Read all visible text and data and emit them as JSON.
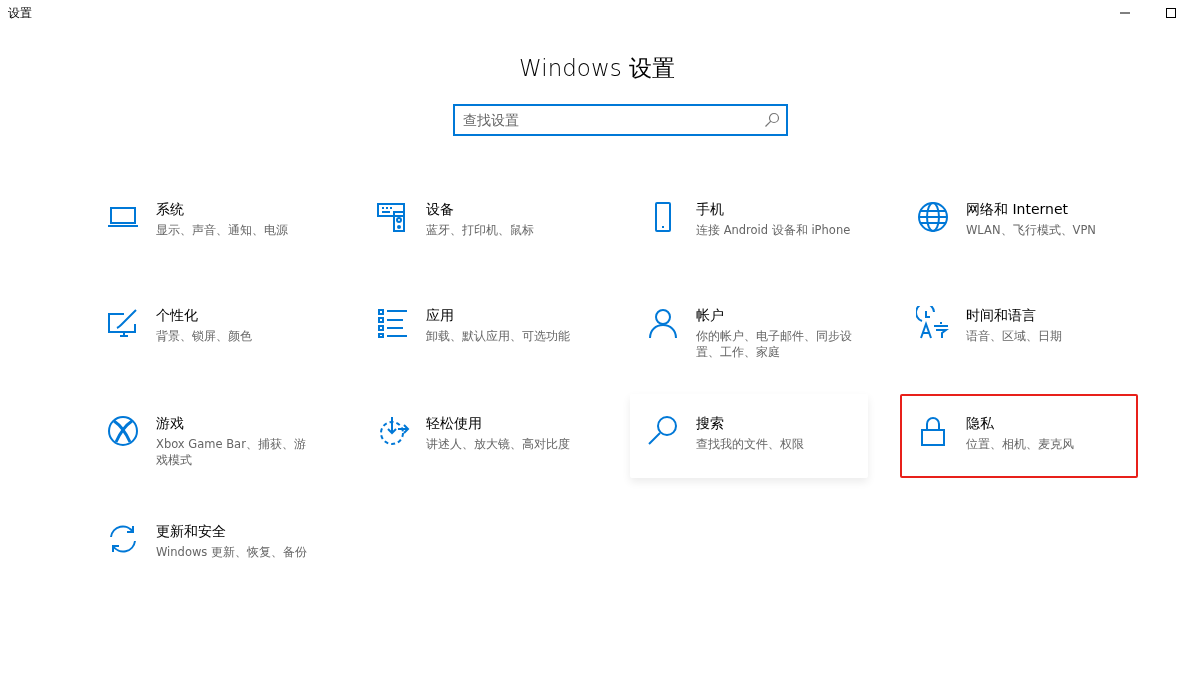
{
  "window": {
    "title": "设置"
  },
  "heading": "Windows 设置",
  "search": {
    "placeholder": "查找设置"
  },
  "tiles": [
    {
      "kind": "system",
      "title": "系统",
      "subtitle": "显示、声音、通知、电源",
      "highlighted": false,
      "hovered": false
    },
    {
      "kind": "devices",
      "title": "设备",
      "subtitle": "蓝牙、打印机、鼠标",
      "highlighted": false,
      "hovered": false
    },
    {
      "kind": "phone",
      "title": "手机",
      "subtitle": "连接 Android 设备和 iPhone",
      "highlighted": false,
      "hovered": false
    },
    {
      "kind": "network",
      "title": "网络和 Internet",
      "subtitle": "WLAN、飞行模式、VPN",
      "highlighted": false,
      "hovered": false
    },
    {
      "kind": "personalization",
      "title": "个性化",
      "subtitle": "背景、锁屏、颜色",
      "highlighted": false,
      "hovered": false
    },
    {
      "kind": "apps",
      "title": "应用",
      "subtitle": "卸载、默认应用、可选功能",
      "highlighted": false,
      "hovered": false
    },
    {
      "kind": "accounts",
      "title": "帐户",
      "subtitle": "你的帐户、电子邮件、同步设置、工作、家庭",
      "highlighted": false,
      "hovered": false
    },
    {
      "kind": "time",
      "title": "时间和语言",
      "subtitle": "语音、区域、日期",
      "highlighted": false,
      "hovered": false
    },
    {
      "kind": "gaming",
      "title": "游戏",
      "subtitle": "Xbox Game Bar、捕获、游戏模式",
      "highlighted": false,
      "hovered": false
    },
    {
      "kind": "ease",
      "title": "轻松使用",
      "subtitle": "讲述人、放大镜、高对比度",
      "highlighted": false,
      "hovered": false
    },
    {
      "kind": "search",
      "title": "搜索",
      "subtitle": "查找我的文件、权限",
      "highlighted": false,
      "hovered": true
    },
    {
      "kind": "privacy",
      "title": "隐私",
      "subtitle": "位置、相机、麦克风",
      "highlighted": true,
      "hovered": false
    },
    {
      "kind": "update",
      "title": "更新和安全",
      "subtitle": "Windows 更新、恢复、备份",
      "highlighted": false,
      "hovered": false
    }
  ]
}
